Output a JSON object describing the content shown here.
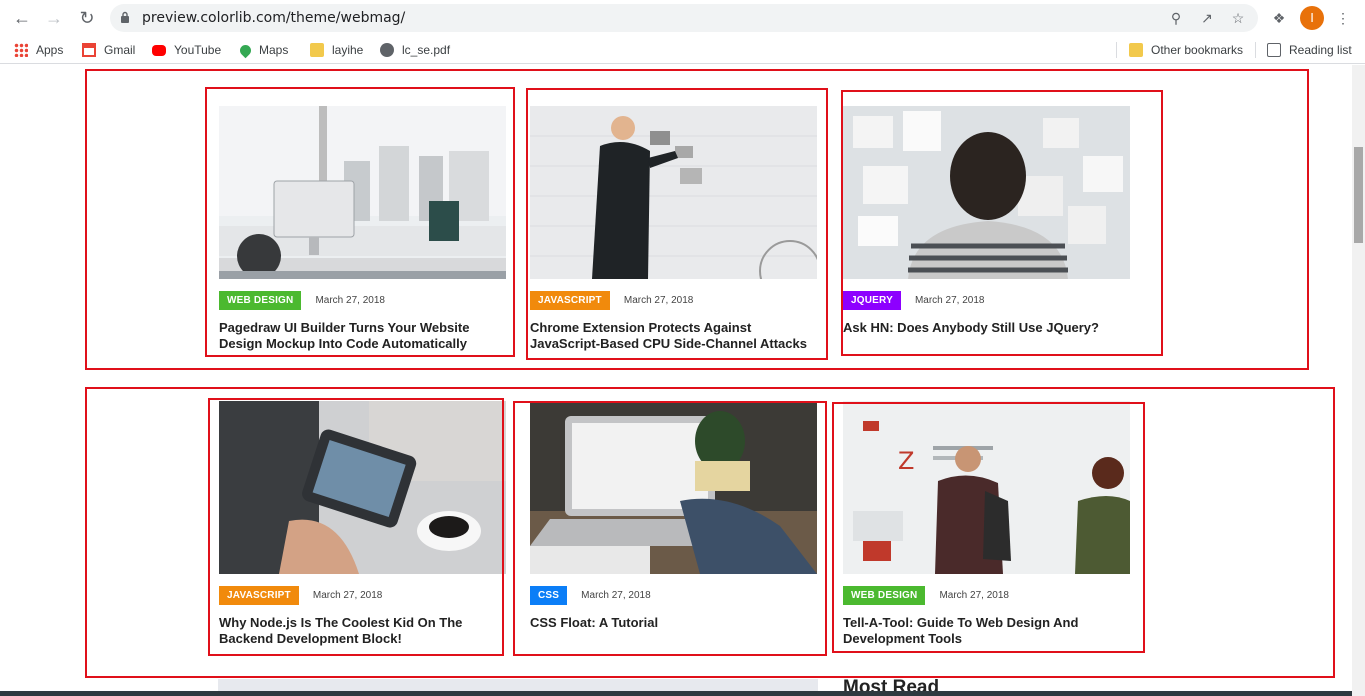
{
  "browser": {
    "url": "preview.colorlib.com/theme/webmag/",
    "profile_initial": "I",
    "bookmarks": [
      "Apps",
      "Gmail",
      "YouTube",
      "Maps",
      "layihe",
      "lc_se.pdf"
    ],
    "other_bookmarks": "Other bookmarks",
    "reading_list": "Reading list"
  },
  "colors": {
    "web_design": "#4bb92f",
    "javascript": "#f18a0c",
    "jquery": "#8d00ff",
    "css": "#0b7ef7",
    "annotation": "#e0101a"
  },
  "row1": [
    {
      "tag": "WEB DESIGN",
      "date": "March 27, 2018",
      "title": "Pagedraw UI Builder Turns Your Website Design Mockup Into Code Automatically"
    },
    {
      "tag": "JAVASCRIPT",
      "date": "March 27, 2018",
      "title": "Chrome Extension Protects Against JavaScript-Based CPU Side-Channel Attacks"
    },
    {
      "tag": "JQUERY",
      "date": "March 27, 2018",
      "title": "Ask HN: Does Anybody Still Use JQuery?"
    }
  ],
  "row2": [
    {
      "tag": "JAVASCRIPT",
      "date": "March 27, 2018",
      "title": "Why Node.js Is The Coolest Kid On The Backend Development Block!"
    },
    {
      "tag": "CSS",
      "date": "March 27, 2018",
      "title": "CSS Float: A Tutorial"
    },
    {
      "tag": "WEB DESIGN",
      "date": "March 27, 2018",
      "title": "Tell-A-Tool: Guide To Web Design And Development Tools"
    }
  ],
  "sidebar": {
    "most_read": "Most Read"
  }
}
